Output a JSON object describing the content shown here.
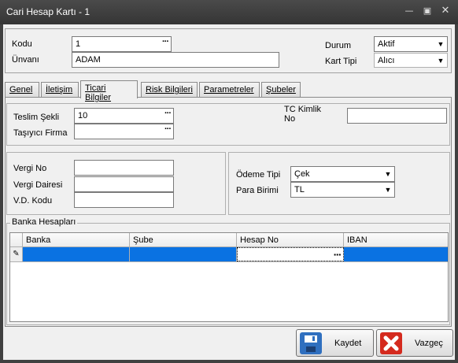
{
  "window": {
    "title": "Cari Hesap Kartı - 1"
  },
  "header": {
    "kodu_label": "Kodu",
    "kodu_value": "1",
    "unvani_label": "Ünvanı",
    "unvani_value": "ADAM",
    "durum_label": "Durum",
    "durum_value": "Aktif",
    "kart_tipi_label": "Kart Tipi",
    "kart_tipi_value": "Alıcı"
  },
  "tabs": [
    "Genel",
    "İletişim",
    "Ticari Bilgiler",
    "Risk Bilgileri",
    "Parametreler",
    "Şubeler"
  ],
  "active_tab": "Ticari Bilgiler",
  "ticari": {
    "teslim_label": "Teslim Şekli",
    "teslim_value": "10",
    "tasiyici_label": "Taşıyıcı Firma",
    "tasiyici_value": "",
    "tc_label": "TC Kimlik No",
    "tc_value": "",
    "vergi_no_label": "Vergi No",
    "vergi_dairesi_label": "Vergi Dairesi",
    "vd_kodu_label": "V.D. Kodu",
    "odeme_label": "Ödeme Tipi",
    "odeme_value": "Çek",
    "para_label": "Para Birimi",
    "para_value": "TL"
  },
  "banka": {
    "title": "Banka Hesapları",
    "columns": [
      "Banka",
      "Şube",
      "Hesap No",
      "IBAN"
    ]
  },
  "footer": {
    "save_label": "Kaydet",
    "cancel_label": "Vazgeç"
  },
  "colors": {
    "selection": "#0a72e2",
    "save_icon": "#2f6fbf",
    "cancel_icon": "#d42a1e"
  },
  "icons": [
    "minimize-icon",
    "maximize-icon",
    "close-icon",
    "pencil-icon",
    "floppy-disk-icon",
    "cross-icon"
  ]
}
